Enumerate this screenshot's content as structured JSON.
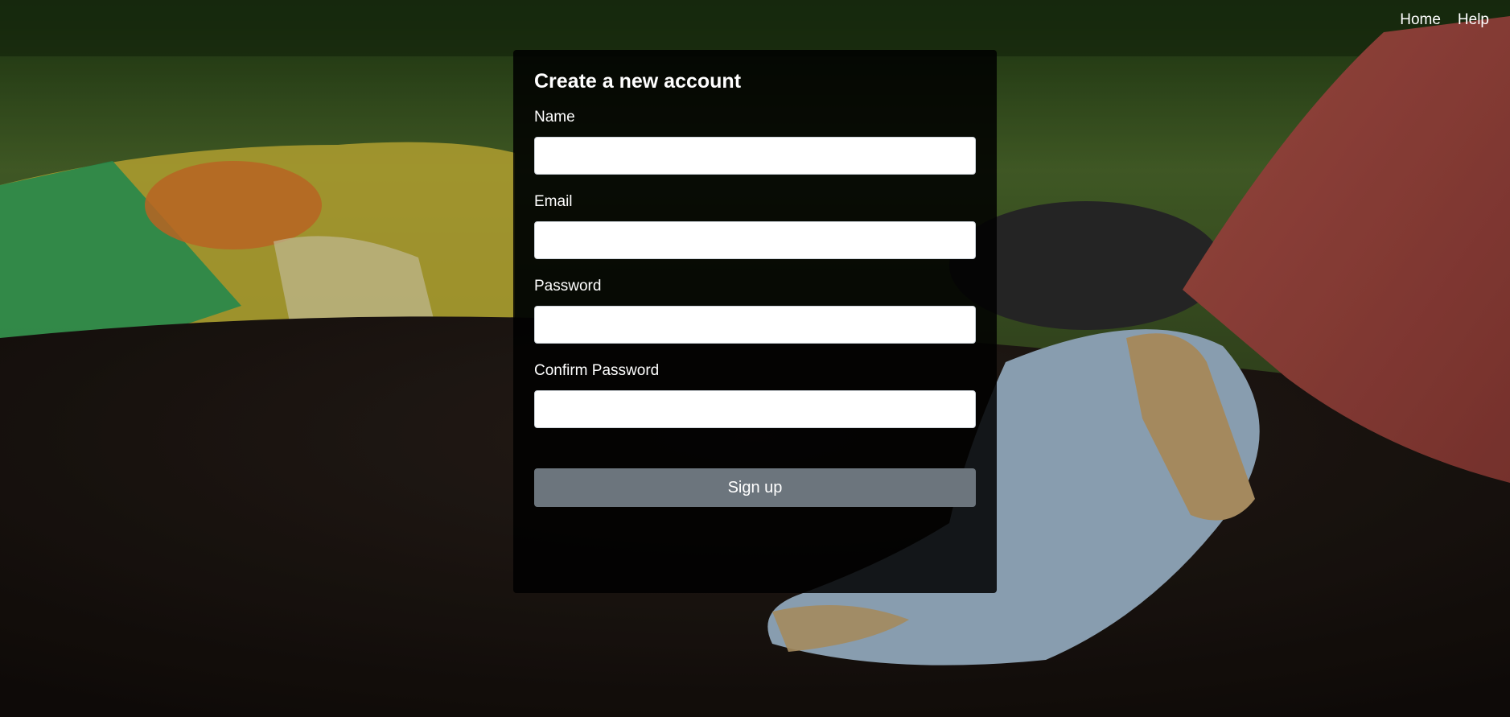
{
  "nav": {
    "home_label": "Home",
    "help_label": "Help"
  },
  "form": {
    "title": "Create a new account",
    "fields": [
      {
        "label": "Name",
        "value": ""
      },
      {
        "label": "Email",
        "value": ""
      },
      {
        "label": "Password",
        "value": ""
      },
      {
        "label": "Confirm Password",
        "value": ""
      }
    ],
    "submit_label": "Sign up"
  },
  "colors": {
    "panel_background": "#000000",
    "button_background": "#6c757d",
    "text": "#ffffff"
  }
}
